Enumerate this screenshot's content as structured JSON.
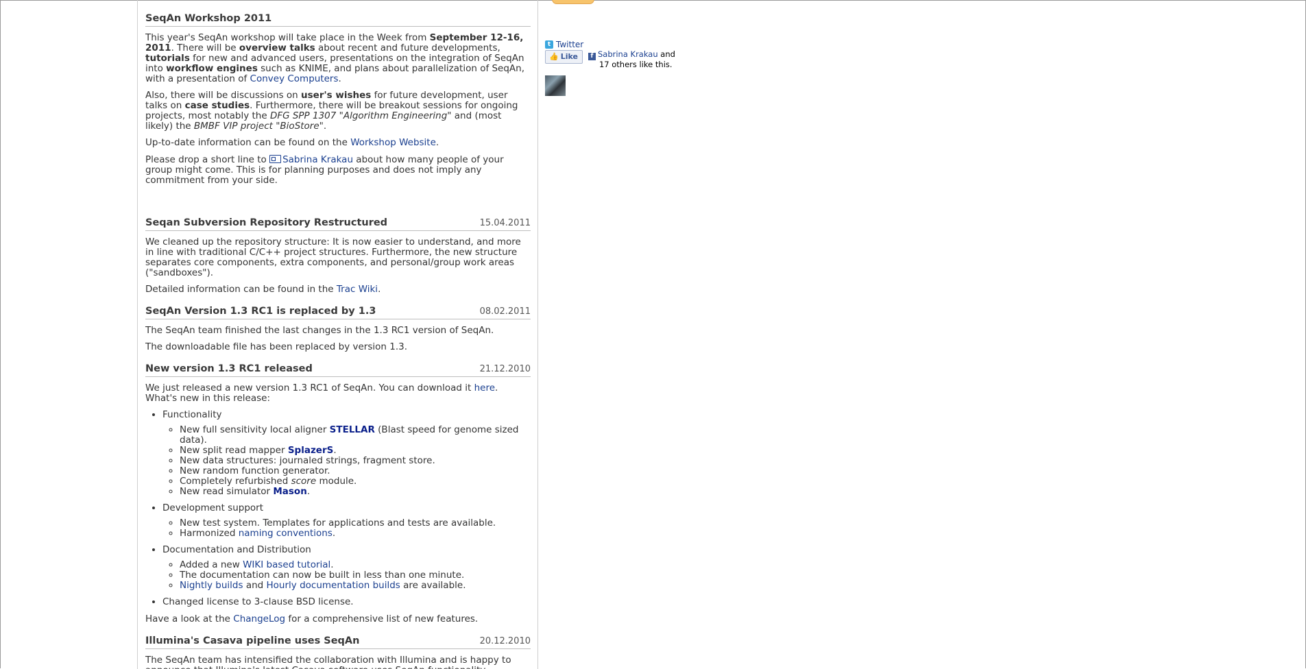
{
  "articles": [
    {
      "title": "SeqAn Workshop 2011",
      "date": "",
      "p1": {
        "a": "This year's SeqAn workshop will take place in the Week from ",
        "b": "September 12-16, 2011",
        "c": ". There will be ",
        "d": "overview talks",
        "e": " about recent and future developments, ",
        "f": "tutorials",
        "g": " for new and advanced users, presentations on the integration of SeqAn into ",
        "h": "workflow engines",
        "i": " such as KNIME, and plans about parallelization of SeqAn, with a presentation of ",
        "link": "Convey Computers",
        "j": "."
      },
      "p2": {
        "a": "Also, there will be discussions on ",
        "b": "user's wishes",
        "c": " for future development, user talks on ",
        "d": "case studies",
        "e": ". Furthermore, there will be breakout sessions for ongoing projects, most notably the ",
        "f": "DFG SPP 1307 \"Algorithm Engineering\"",
        "g": " and (most likely) the ",
        "h": "BMBF VIP project \"BioStore\"",
        "i": "."
      },
      "p3": {
        "a": "Up-to-date information can be found on the ",
        "link": "Workshop Website",
        "b": "."
      },
      "p4": {
        "a": "Please drop a short line to ",
        "link": "Sabrina Krakau",
        "b": " about how many people of your group might come. This is for planning purposes and does not imply any commitment from your side."
      }
    },
    {
      "title": "Seqan Subversion Repository Restructured",
      "date": "15.04.2011",
      "p1": "We cleaned up the repository structure: It is now easier to understand, and more in line with traditional C/C++ project structures. Furthermore, the new structure separates core components, extra components, and personal/group work areas (\"sandboxes\").",
      "p2": {
        "a": "Detailed information can be found in the ",
        "link": "Trac Wiki",
        "b": "."
      }
    },
    {
      "title": "SeqAn Version 1.3 RC1 is replaced by 1.3",
      "date": "08.02.2011",
      "p1": "The SeqAn team finished the last changes in the 1.3 RC1 version of SeqAn.",
      "p2": "The downloadable file has been replaced by version 1.3."
    },
    {
      "title": "New version 1.3 RC1 released",
      "date": "21.12.2010",
      "p1": {
        "a": "We just released a new version 1.3 RC1 of SeqAn. You can download it ",
        "link": "here",
        "b": ". What's new in this release:"
      },
      "functionality": {
        "label": "Functionality",
        "i1": {
          "a": "New full sensitivity local aligner ",
          "b": "STELLAR",
          "c": " (Blast speed for genome sized data)."
        },
        "i2": {
          "a": "New split read mapper ",
          "b": "SplazerS",
          "c": "."
        },
        "i3": "New data structures: journaled strings, fragment store.",
        "i4": "New random function generator.",
        "i5": {
          "a": "Completely refurbished ",
          "b": "score",
          "c": " module."
        },
        "i6": {
          "a": "New read simulator ",
          "b": "Mason",
          "c": "."
        }
      },
      "devsupport": {
        "label": "Development support",
        "i1": "New test system. Templates for applications and tests are available.",
        "i2": {
          "a": "Harmonized ",
          "link": "naming conventions",
          "b": "."
        }
      },
      "docs": {
        "label": "Documentation and Distribution",
        "i1": {
          "a": "Added a new ",
          "link": "WIKI based tutorial",
          "b": "."
        },
        "i2": "The documentation can now be built in less than one minute.",
        "i3": {
          "link1": "Nightly builds",
          "a": " and ",
          "link2": "Hourly documentation builds",
          "b": " are available."
        }
      },
      "license": "Changed license to 3-clause BSD license.",
      "p_end": {
        "a": "Have a look at the ",
        "link": "ChangeLog",
        "b": " for a comprehensive list of new features."
      }
    },
    {
      "title": "Illumina's Casava pipeline uses SeqAn",
      "date": "20.12.2010",
      "p1": "The SeqAn team has intensified the collaboration with Illumina and is happy to announce that Illumina's latest Casava software uses SeqAn functionality."
    }
  ],
  "sidebar": {
    "twitter_label": "Twitter",
    "twitter_icon": "twitter-icon",
    "like_label": "Like",
    "fb_name": "Sabrina Krakau",
    "fb_and": " and",
    "fb_others": "17 others like this."
  },
  "colors": {
    "link": "#1a3f8f",
    "strong_link": "#0a1f8a",
    "text": "#333333"
  }
}
